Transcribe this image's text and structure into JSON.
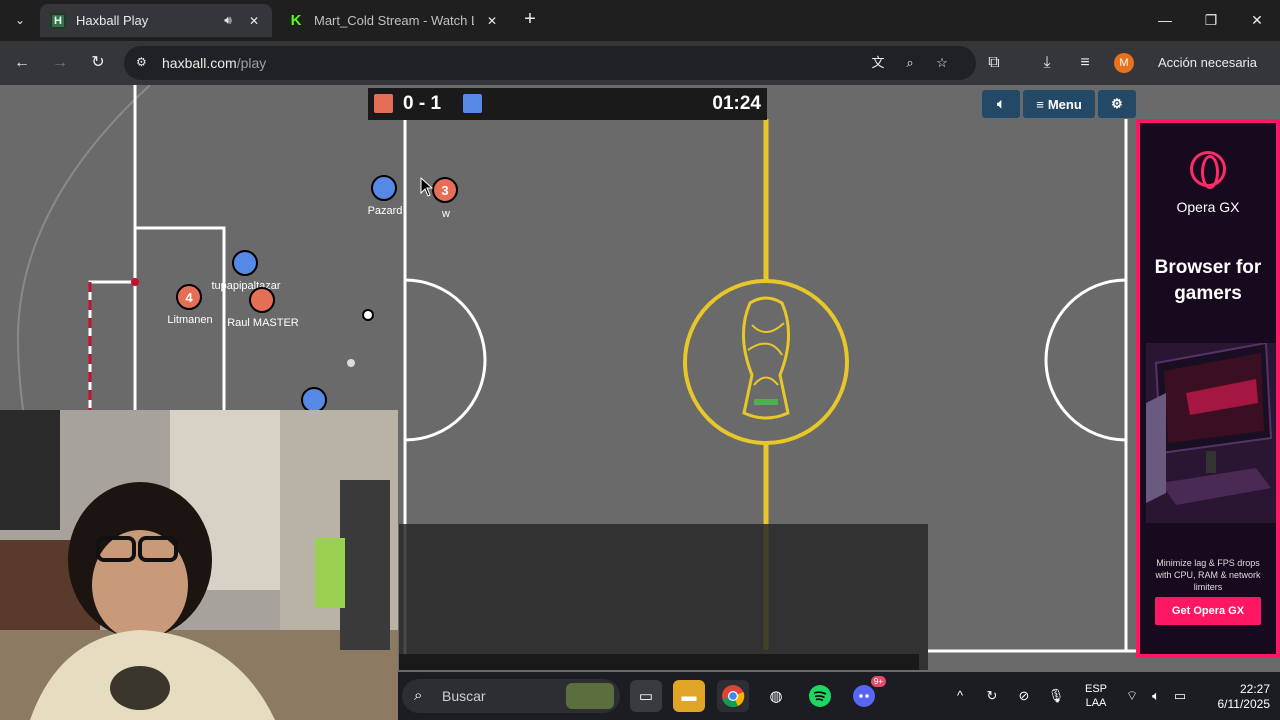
{
  "browser": {
    "tabs": [
      {
        "title": "Haxball Play",
        "favicon": "haxball-favicon",
        "audio_icon": "speaker-icon"
      },
      {
        "title": "Mart_Cold Stream - Watch Live",
        "favicon": "kick-favicon"
      }
    ],
    "url_host": "haxball.com",
    "url_path": "/play",
    "profile_initial": "M",
    "action_label": "Acción necesaria"
  },
  "game": {
    "score": "0 - 1",
    "time": "01:24",
    "menu_label": "Menu",
    "colors": {
      "red_team": "#e56e56",
      "blue_team": "#5689e5",
      "pitch": "#6a6a6a",
      "line_gold": "#e8c72b"
    },
    "players": [
      {
        "team": "blue",
        "avatar": "",
        "name": "Pazard"
      },
      {
        "team": "red",
        "avatar": "3",
        "name": "w"
      },
      {
        "team": "blue",
        "avatar": "",
        "name": "tupapipaltazar"
      },
      {
        "team": "red",
        "avatar": "4",
        "name": "Litmanen"
      },
      {
        "team": "red",
        "avatar": "",
        "name": "Raul MASTER"
      },
      {
        "team": "blue",
        "avatar": "",
        "name": ""
      }
    ]
  },
  "ad": {
    "brand": "Opera GX",
    "headline": "Browser for gamers",
    "subtext": "Minimize lag & FPS drops with CPU, RAM & network limiters",
    "cta": "Get Opera GX",
    "accent": "#ff1763"
  },
  "taskbar": {
    "search_placeholder": "Buscar",
    "lang_line1": "ESP",
    "lang_line2": "LAA",
    "time": "22:27",
    "date": "6/11/2025",
    "discord_badge": "9+"
  }
}
